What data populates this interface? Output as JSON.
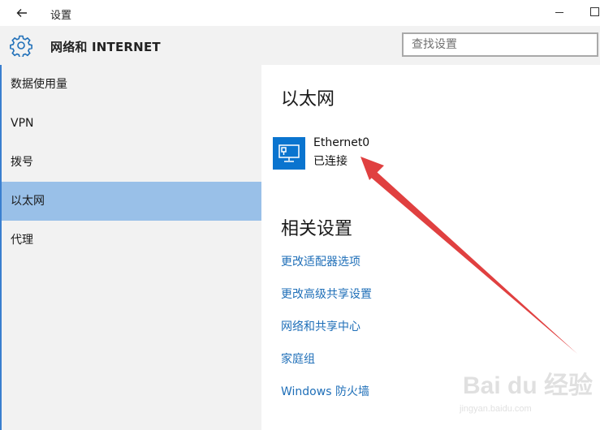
{
  "window": {
    "title": "设置"
  },
  "header": {
    "title": "网络和 INTERNET",
    "search_placeholder": "查找设置"
  },
  "sidebar": {
    "items": [
      {
        "label": "数据使用量"
      },
      {
        "label": "VPN"
      },
      {
        "label": "拨号"
      },
      {
        "label": "以太网",
        "active": true
      },
      {
        "label": "代理"
      }
    ]
  },
  "main": {
    "title": "以太网",
    "adapter": {
      "name": "Ethernet0",
      "status": "已连接"
    },
    "related_title": "相关设置",
    "links": [
      {
        "label": "更改适配器选项"
      },
      {
        "label": "更改高级共享设置"
      },
      {
        "label": "网络和共享中心"
      },
      {
        "label": "家庭组"
      },
      {
        "label": "Windows 防火墙"
      }
    ]
  },
  "watermark": {
    "text": "Bai du 经验",
    "url": "jingyan.baidu.com"
  },
  "colors": {
    "accent": "#0a74cf",
    "selected": "#99c0e8",
    "link": "#1f6fb8",
    "annotation_arrow": "#e04040"
  }
}
